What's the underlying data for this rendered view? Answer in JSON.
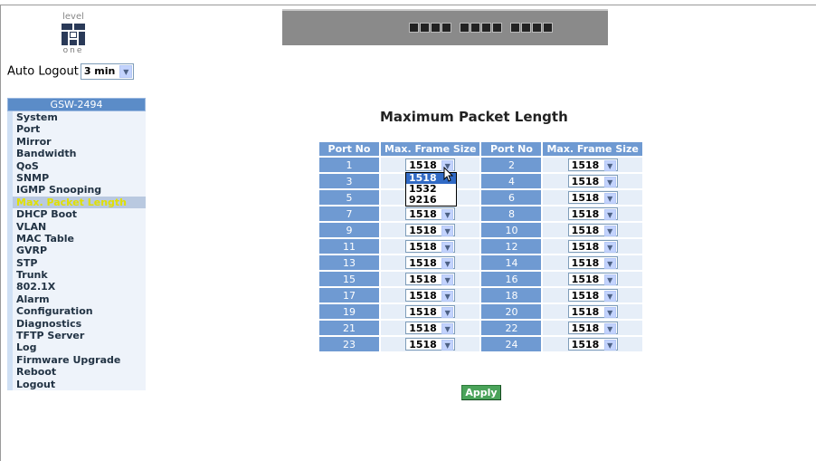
{
  "logo": {
    "top_text": "level",
    "bottom_text": "one"
  },
  "header": {
    "auto_logout_label": "Auto Logout",
    "auto_logout_value": "3 min"
  },
  "menu": {
    "title": "GSW-2494",
    "items": [
      "System",
      "Port",
      "Mirror",
      "Bandwidth",
      "QoS",
      "SNMP",
      "IGMP Snooping",
      "Max. Packet Length",
      "DHCP Boot",
      "VLAN",
      "MAC Table",
      "GVRP",
      "STP",
      "Trunk",
      "802.1X",
      "Alarm",
      "Configuration",
      "Diagnostics",
      "TFTP Server",
      "Log",
      "Firmware Upgrade",
      "Reboot",
      "Logout"
    ],
    "active": "Max. Packet Length"
  },
  "main": {
    "title": "Maximum Packet Length",
    "headers": [
      "Port No",
      "Max. Frame Size",
      "Port No",
      "Max. Frame Size"
    ],
    "rows": [
      {
        "port_a": "1",
        "size_a": "1518",
        "port_b": "2",
        "size_b": "1518"
      },
      {
        "port_a": "3",
        "size_a": "1518",
        "port_b": "4",
        "size_b": "1518"
      },
      {
        "port_a": "5",
        "size_a": "1518",
        "port_b": "6",
        "size_b": "1518"
      },
      {
        "port_a": "7",
        "size_a": "1518",
        "port_b": "8",
        "size_b": "1518"
      },
      {
        "port_a": "9",
        "size_a": "1518",
        "port_b": "10",
        "size_b": "1518"
      },
      {
        "port_a": "11",
        "size_a": "1518",
        "port_b": "12",
        "size_b": "1518"
      },
      {
        "port_a": "13",
        "size_a": "1518",
        "port_b": "14",
        "size_b": "1518"
      },
      {
        "port_a": "15",
        "size_a": "1518",
        "port_b": "16",
        "size_b": "1518"
      },
      {
        "port_a": "17",
        "size_a": "1518",
        "port_b": "18",
        "size_b": "1518"
      },
      {
        "port_a": "19",
        "size_a": "1518",
        "port_b": "20",
        "size_b": "1518"
      },
      {
        "port_a": "21",
        "size_a": "1518",
        "port_b": "22",
        "size_b": "1518"
      },
      {
        "port_a": "23",
        "size_a": "1518",
        "port_b": "24",
        "size_b": "1518"
      }
    ],
    "open_dropdown": {
      "options": [
        "1518",
        "1532",
        "9216"
      ],
      "highlighted": "1518"
    },
    "apply_label": "Apply"
  },
  "colors": {
    "header_blue": "#6f9ad2",
    "cell_bg": "#e6eef8",
    "apply_green": "#4aa35a",
    "active_menu": "#e0e000"
  }
}
